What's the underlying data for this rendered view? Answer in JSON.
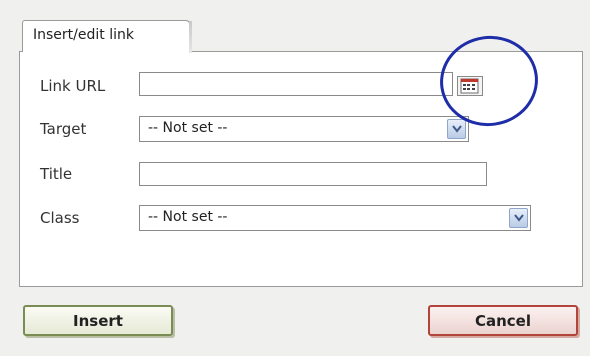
{
  "dialog": {
    "tab_label": "Insert/edit link",
    "fields": {
      "link_url": {
        "label": "Link URL",
        "value": ""
      },
      "target": {
        "label": "Target",
        "value": "-- Not set --"
      },
      "title": {
        "label": "Title",
        "value": ""
      },
      "class": {
        "label": "Class",
        "value": "-- Not set --"
      }
    },
    "buttons": {
      "insert": "Insert",
      "cancel": "Cancel"
    }
  },
  "colors": {
    "annotation_circle": "#1e2ea8",
    "insert_border": "#7a8b53",
    "cancel_border": "#b1453a"
  },
  "icons": {
    "browse": "file-browser-icon",
    "dropdown": "chevron-down-icon"
  }
}
